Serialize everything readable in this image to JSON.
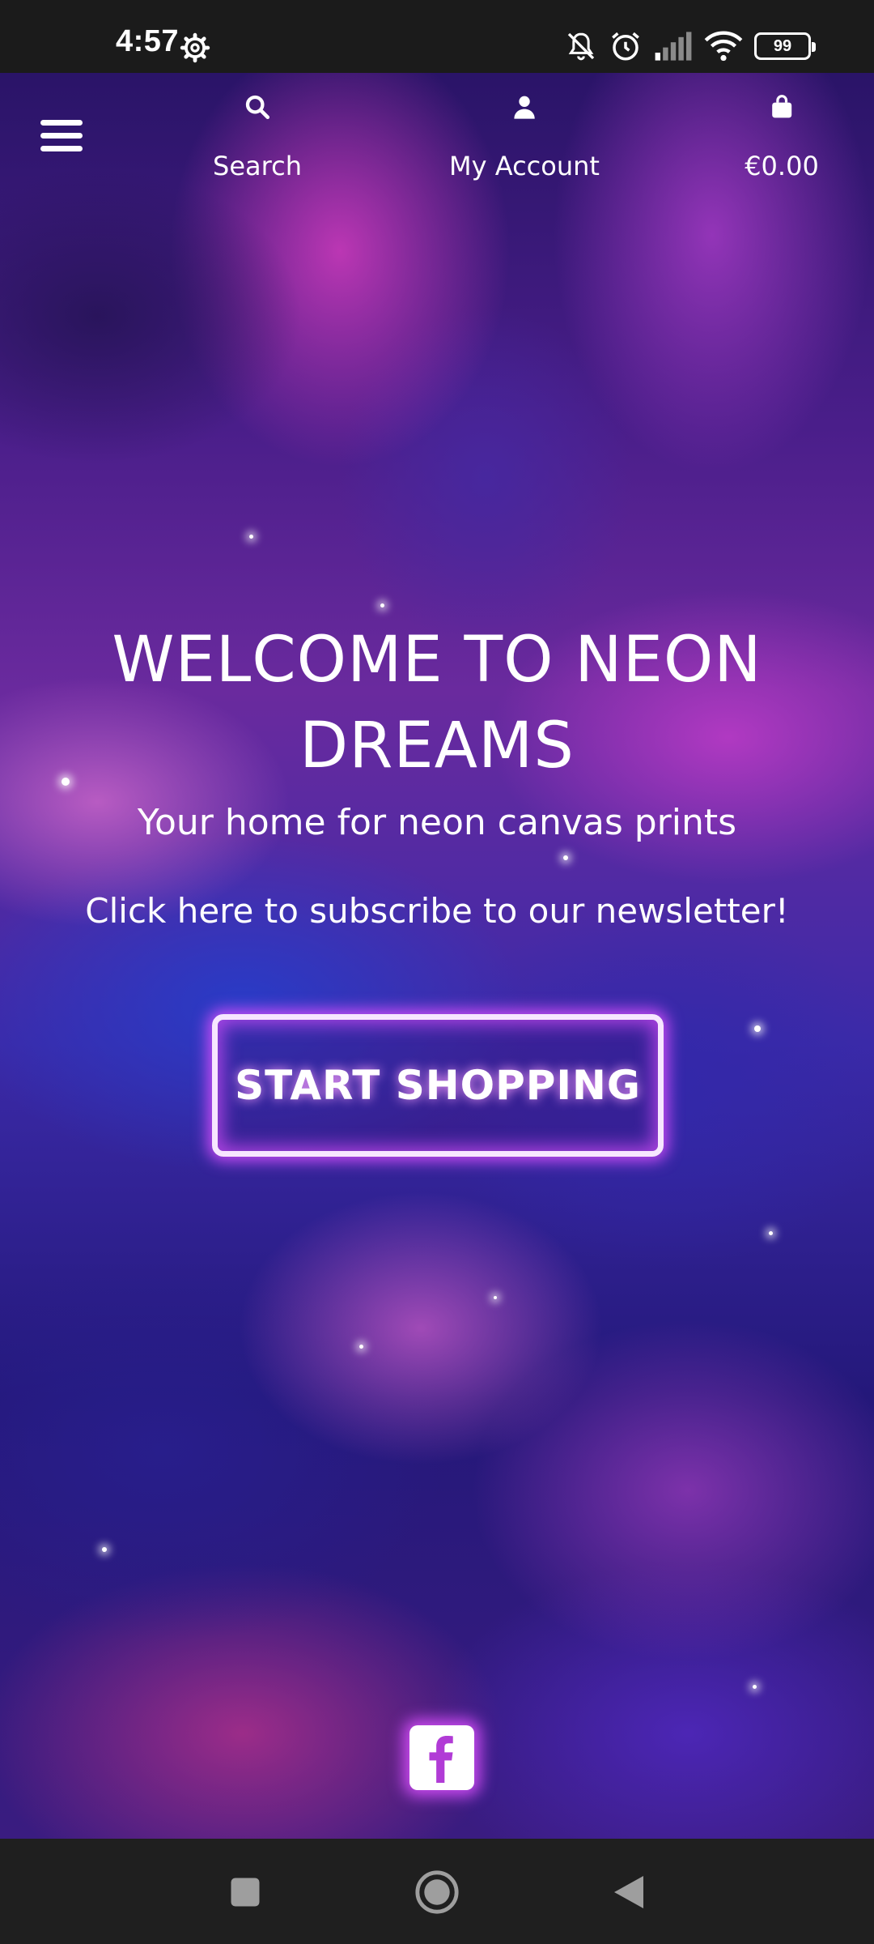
{
  "status_bar": {
    "time": "4:57",
    "battery": "99",
    "icons": [
      "settings-icon",
      "mute-icon",
      "alarm-icon",
      "signal-icon",
      "wifi-icon",
      "battery-icon"
    ]
  },
  "header": {
    "menu_icon": "hamburger-menu-icon",
    "nav": [
      {
        "label": "Search",
        "icon": "search-icon"
      },
      {
        "label": "My Account",
        "icon": "user-icon"
      },
      {
        "label": "€0.00",
        "icon": "shopping-bag-icon"
      }
    ]
  },
  "hero": {
    "title": "WELCOME TO NEON DREAMS",
    "subtitle": "Your home for neon canvas prints",
    "newsletter_prefix": "Click",
    "newsletter_link": "here",
    "newsletter_suffix": "to subscribe to our newsletter!",
    "button_label": "START SHOPPING"
  },
  "footer": {
    "social_icon": "facebook-icon"
  },
  "system_nav": {
    "buttons": [
      "recents-button",
      "home-button",
      "back-button"
    ]
  },
  "colors": {
    "accent_glow": "#dc50ff",
    "text": "#ffffff",
    "bar_background": "#1b1b1b"
  }
}
